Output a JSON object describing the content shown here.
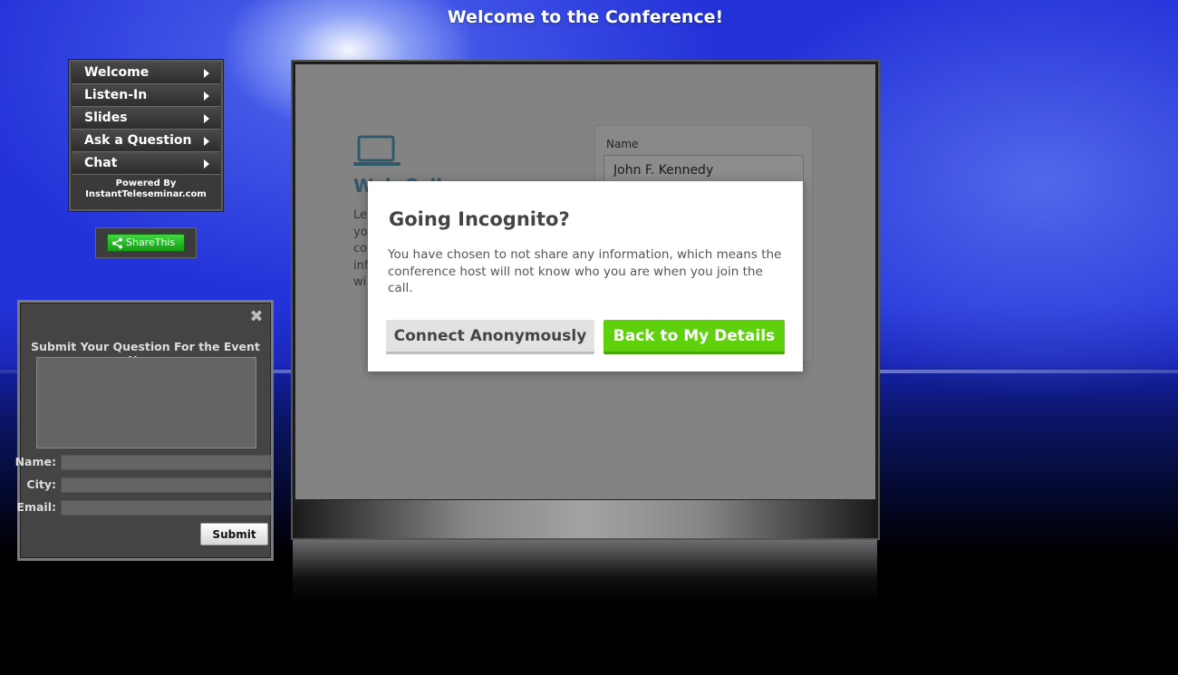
{
  "page": {
    "title": "Welcome to the Conference!"
  },
  "nav": {
    "items": [
      {
        "label": "Welcome"
      },
      {
        "label": "Listen-In"
      },
      {
        "label": "Slides"
      },
      {
        "label": "Ask a Question"
      },
      {
        "label": "Chat"
      }
    ],
    "powered_line1": "Powered By",
    "powered_line2": "InstantTeleseminar.com"
  },
  "share": {
    "label": "ShareThis",
    "color": "#1fbf1f"
  },
  "question_panel": {
    "close_icon": "close-icon",
    "title": "Submit Your Question For the Event Here:",
    "question_value": "",
    "name_label": "Name:",
    "city_label": "City:",
    "email_label": "Email:",
    "name_value": "",
    "city_value": "",
    "email_value": "",
    "submit_label": "Submit"
  },
  "stage": {
    "icon": "laptop-icon",
    "title_partial": "Web Call",
    "left_text_lines": [
      "Le",
      "yo",
      "co",
      "inf",
      "wi"
    ],
    "form": {
      "name_label": "Name",
      "name_value": "John F. Kennedy"
    }
  },
  "modal": {
    "title": "Going Incognito?",
    "text": "You have chosen to not share any information, which means the conference host will not know who you are when you join the call.",
    "anon_button": "Connect Anonymously",
    "back_button": "Back to My Details",
    "accent": "#5ed10c"
  }
}
